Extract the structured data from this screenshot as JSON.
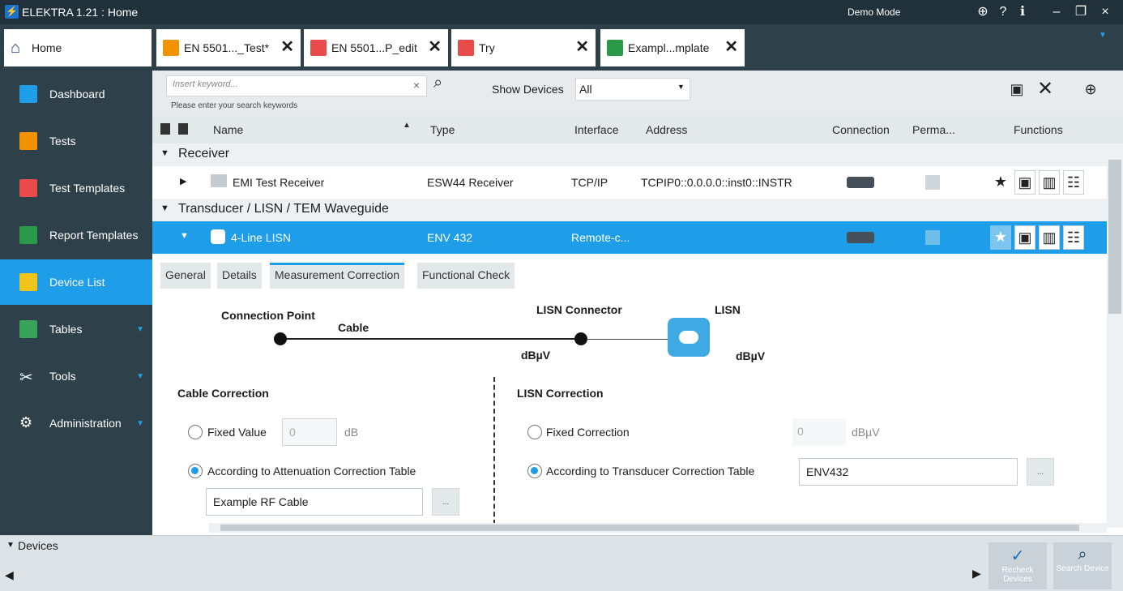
{
  "titlebar": {
    "title": "ELEKTRA 1.21 : Home",
    "mode": "Demo Mode"
  },
  "tabs": [
    {
      "label": "Home"
    },
    {
      "label": "EN 5501..._Test*"
    },
    {
      "label": "EN 5501...P_edit"
    },
    {
      "label": "Try"
    },
    {
      "label": "Exampl...mplate"
    }
  ],
  "sidebar": {
    "items": [
      {
        "label": "Dashboard"
      },
      {
        "label": "Tests"
      },
      {
        "label": "Test Templates"
      },
      {
        "label": "Report Templates"
      },
      {
        "label": "Device List"
      },
      {
        "label": "Tables"
      },
      {
        "label": "Tools"
      },
      {
        "label": "Administration"
      }
    ]
  },
  "search": {
    "placeholder": "Insert keyword...",
    "hint": "Please enter your search keywords",
    "clear": "×",
    "show_devices_label": "Show Devices",
    "show_devices_value": "All"
  },
  "table": {
    "columns": [
      "Name",
      "Type",
      "Interface",
      "Address",
      "Connection",
      "Perma...",
      "Functions"
    ],
    "groups": [
      "Receiver",
      "Transducer / LISN / TEM Waveguide"
    ],
    "rows": [
      {
        "name": "EMI Test Receiver",
        "type": "ESW44 Receiver",
        "interface": "TCP/IP",
        "address": "TCPIP0::0.0.0.0::inst0::INSTR"
      },
      {
        "name": "4-Line LISN",
        "type": "ENV 432",
        "interface": "Remote-c...",
        "address": ""
      }
    ]
  },
  "subtabs": [
    "General",
    "Details",
    "Measurement Correction",
    "Functional Check"
  ],
  "diagram": {
    "connection_point": "Connection Point",
    "cable": "Cable",
    "lisn_connector": "LISN Connector",
    "lisn": "LISN",
    "unit1": "dBµV",
    "unit2": "dBµV"
  },
  "cable_correction": {
    "title": "Cable Correction",
    "fixed_label": "Fixed Value",
    "fixed_value": "0",
    "fixed_unit": "dB",
    "table_label": "According to Attenuation Correction Table",
    "table_value": "Example RF Cable",
    "browse": "..."
  },
  "lisn_correction": {
    "title": "LISN Correction",
    "fixed_label": "Fixed Correction",
    "fixed_value": "0",
    "fixed_unit": "dBµV",
    "table_label": "According to Transducer Correction Table",
    "table_value": "ENV432",
    "browse": "..."
  },
  "bottom": {
    "devices_label": "Devices",
    "recheck": "Recheck Devices",
    "search": "Search Device"
  },
  "colors": {
    "accent": "#1e9de8",
    "sidebar": "#2e404a",
    "titlebar": "#21313b"
  }
}
